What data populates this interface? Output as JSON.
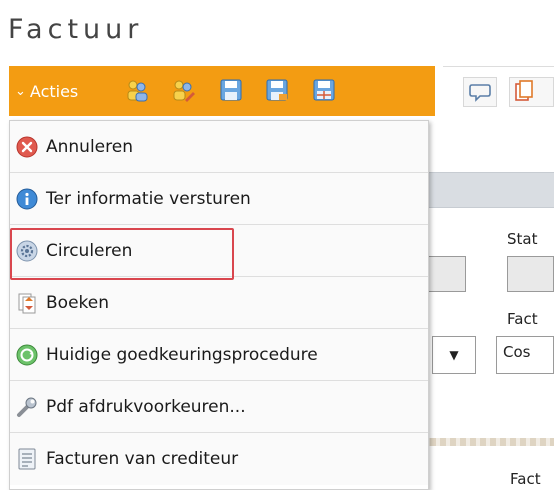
{
  "page": {
    "title": "Factuur"
  },
  "toolbar": {
    "acties_label": "Acties",
    "accent_color": "#f39c12",
    "icons": [
      "users-icon",
      "users-edit-icon",
      "save-icon",
      "save-close-icon",
      "save-grid-icon"
    ],
    "secondary_icons": [
      "comment-icon",
      "copy-icon"
    ]
  },
  "menu": {
    "items": [
      {
        "label": "Annuleren",
        "icon": "cancel-icon"
      },
      {
        "label": "Ter informatie versturen",
        "icon": "info-icon"
      },
      {
        "label": "Circuleren",
        "icon": "gear-icon",
        "highlighted": true
      },
      {
        "label": "Boeken",
        "icon": "book-icon"
      },
      {
        "label": "Huidige goedkeuringsprocedure",
        "icon": "approval-icon"
      },
      {
        "label": "Pdf afdrukvoorkeuren...",
        "icon": "wrench-icon"
      },
      {
        "label": "Facturen van crediteur",
        "icon": "document-icon"
      }
    ]
  },
  "background_form": {
    "status_label": "Stat",
    "factuur_label": "Fact",
    "factuur_label_2": "Fact",
    "select_value": "Cos",
    "select_arrow": "▼"
  }
}
